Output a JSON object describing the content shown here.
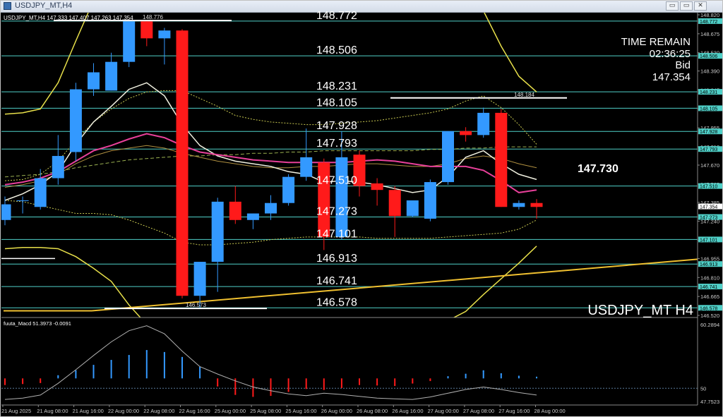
{
  "window": {
    "title": "USDJPY_MT,H4",
    "minimize_glyph": "▭",
    "restore_glyph": "▭",
    "close_glyph": "✕"
  },
  "ohlc_header": "USDJPY_MT,H4  147.333 147.407 147.263 147.354",
  "symbol_watermark": "USDJPY_MT H4",
  "info_panel": {
    "time_remain_label": "TIME REMAIN",
    "time_remain_value": "02:36:25",
    "bid_label": "Bid",
    "bid_value": "147.354"
  },
  "target_price_label": "147.730",
  "macd_header": "fuuta_Macd 51.3973 -0.0091",
  "colors": {
    "bull": "#3399ff",
    "bear": "#ff1a1a",
    "level_line": "#4fd0c8",
    "band": "#e8e04a",
    "ma_pink": "#e8409a",
    "ma_white": "#f0f0e0",
    "ma_dashed": "#c8c850",
    "trendline": "#f0c030",
    "macd_line": "#b0b0b0",
    "axis_tag_bg": "#4fd0c8"
  },
  "chart_data": {
    "type": "candlestick",
    "symbol": "USDJPY_MT",
    "timeframe": "H4",
    "price_axis_ticks": [
      "148.820",
      "148.675",
      "148.530",
      "148.390",
      "148.245",
      "148.100",
      "147.955",
      "147.810",
      "147.670",
      "147.525",
      "147.385",
      "147.240",
      "147.095",
      "146.955",
      "146.810",
      "146.665",
      "146.520"
    ],
    "price_range": [
      146.52,
      148.82
    ],
    "time_axis_ticks": [
      "21 Aug 2025",
      "21 Aug 08:00",
      "21 Aug 16:00",
      "22 Aug 00:00",
      "22 Aug 08:00",
      "22 Aug 16:00",
      "25 Aug 00:00",
      "25 Aug 08:00",
      "25 Aug 16:00",
      "26 Aug 00:00",
      "26 Aug 08:00",
      "26 Aug 16:00",
      "27 Aug 00:00",
      "27 Aug 08:00",
      "27 Aug 16:00",
      "28 Aug 00:00"
    ],
    "candles": [
      {
        "o": 147.25,
        "h": 147.43,
        "l": 147.21,
        "c": 147.37
      },
      {
        "o": 147.4,
        "h": 147.43,
        "l": 147.3,
        "c": 147.4
      },
      {
        "o": 147.35,
        "h": 147.64,
        "l": 147.33,
        "c": 147.57
      },
      {
        "o": 147.57,
        "h": 147.9,
        "l": 147.52,
        "c": 147.74
      },
      {
        "o": 147.77,
        "h": 148.3,
        "l": 147.7,
        "c": 148.25
      },
      {
        "o": 148.25,
        "h": 148.45,
        "l": 148.2,
        "c": 148.38
      },
      {
        "o": 148.24,
        "h": 148.53,
        "l": 148.24,
        "c": 148.46
      },
      {
        "o": 148.46,
        "h": 148.78,
        "l": 148.42,
        "c": 148.77
      },
      {
        "o": 148.77,
        "h": 148.78,
        "l": 148.58,
        "c": 148.64
      },
      {
        "o": 148.64,
        "h": 148.72,
        "l": 148.44,
        "c": 148.7
      },
      {
        "o": 148.7,
        "h": 148.71,
        "l": 146.65,
        "c": 146.67
      },
      {
        "o": 146.67,
        "h": 146.83,
        "l": 146.58,
        "c": 146.93
      },
      {
        "o": 146.93,
        "h": 147.42,
        "l": 146.7,
        "c": 147.39
      },
      {
        "o": 147.39,
        "h": 147.51,
        "l": 147.22,
        "c": 147.25
      },
      {
        "o": 147.25,
        "h": 147.3,
        "l": 147.18,
        "c": 147.3
      },
      {
        "o": 147.3,
        "h": 147.44,
        "l": 147.25,
        "c": 147.38
      },
      {
        "o": 147.38,
        "h": 147.6,
        "l": 147.36,
        "c": 147.58
      },
      {
        "o": 147.58,
        "h": 147.95,
        "l": 147.55,
        "c": 147.73
      },
      {
        "o": 147.69,
        "h": 147.72,
        "l": 147.02,
        "c": 147.12
      },
      {
        "o": 147.12,
        "h": 147.93,
        "l": 147.1,
        "c": 147.73
      },
      {
        "o": 147.75,
        "h": 147.78,
        "l": 147.43,
        "c": 147.51
      },
      {
        "o": 147.53,
        "h": 147.57,
        "l": 147.36,
        "c": 147.48
      },
      {
        "o": 147.48,
        "h": 147.51,
        "l": 147.12,
        "c": 147.28
      },
      {
        "o": 147.28,
        "h": 147.4,
        "l": 147.27,
        "c": 147.4
      },
      {
        "o": 147.26,
        "h": 147.56,
        "l": 147.24,
        "c": 147.54
      },
      {
        "o": 147.54,
        "h": 147.93,
        "l": 147.52,
        "c": 147.93
      },
      {
        "o": 147.93,
        "h": 147.96,
        "l": 147.85,
        "c": 147.9
      },
      {
        "o": 147.9,
        "h": 148.11,
        "l": 147.88,
        "c": 148.07
      },
      {
        "o": 148.07,
        "h": 148.1,
        "l": 147.35,
        "c": 147.35
      },
      {
        "o": 147.35,
        "h": 147.4,
        "l": 147.33,
        "c": 147.38
      },
      {
        "o": 147.38,
        "h": 147.41,
        "l": 147.26,
        "c": 147.35
      }
    ],
    "levels": [
      {
        "price": 148.772,
        "label": "148.772",
        "tag": "148.772"
      },
      {
        "price": 148.506,
        "label": "148.506",
        "tag": "148.506"
      },
      {
        "price": 148.231,
        "label": "148.231",
        "tag": "148.231"
      },
      {
        "price": 148.105,
        "label": "148.105",
        "tag": "148.105"
      },
      {
        "price": 147.928,
        "label": "147.928",
        "tag": "147.928"
      },
      {
        "price": 147.793,
        "label": "147.793",
        "tag": "147.793"
      },
      {
        "price": 147.51,
        "label": "147.510",
        "tag": "147.510"
      },
      {
        "price": 147.273,
        "label": "147.273",
        "tag": "147.273"
      },
      {
        "price": 147.101,
        "label": "147.101",
        "tag": "147.101"
      },
      {
        "price": 146.913,
        "label": "146.913",
        "tag": "146.913"
      },
      {
        "price": 146.741,
        "label": "146.741",
        "tag": "146.741"
      },
      {
        "price": 146.578,
        "label": "146.578",
        "tag": "146.578"
      }
    ],
    "current_price_tag": "147.354",
    "high_markers": [
      {
        "label": "148.776",
        "price": 148.776
      },
      {
        "label": "148.184",
        "price": 148.184
      },
      {
        "label": "146.573",
        "price": 146.573
      }
    ],
    "macd_axis_ticks": [
      "60.2894",
      "50",
      "47.7523"
    ],
    "macd_range": [
      47.7523,
      60.2894
    ],
    "macd_hist": [
      -1.2,
      -1.0,
      -0.8,
      0.5,
      1.5,
      2.6,
      3.6,
      4.6,
      5.6,
      5.2,
      4.2,
      2.2,
      -1.5,
      -3.2,
      -3.6,
      -3.4,
      -2.6,
      -2.0,
      -2.2,
      -1.8,
      -1.2,
      -1.3,
      -1.4,
      -0.9,
      -0.4,
      0.3,
      0.8,
      1.5,
      0.9,
      0.4,
      0.2
    ],
    "macd_line": [
      48.2,
      48.4,
      48.9,
      50.8,
      53.0,
      55.3,
      57.5,
      59.3,
      60.1,
      58.8,
      56.0,
      53.5,
      52.3,
      51.2,
      50.2,
      49.6,
      49.1,
      48.8,
      49.2,
      49.0,
      48.7,
      48.4,
      48.3,
      48.2,
      48.6,
      49.2,
      49.8,
      50.2,
      49.8,
      49.3,
      48.9
    ]
  }
}
